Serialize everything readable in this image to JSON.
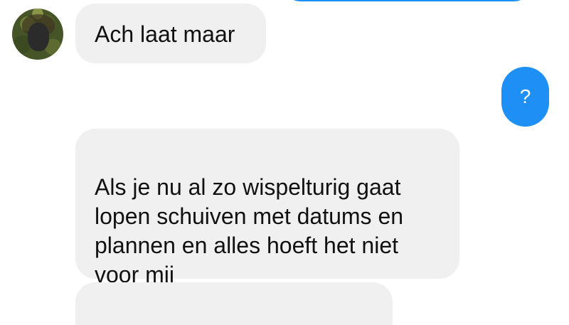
{
  "messages": [
    {
      "from": "contact",
      "text": "Ach laat maar"
    },
    {
      "from": "me",
      "text": "?"
    },
    {
      "from": "contact",
      "text": "Als je nu al zo wispelturig gaat\nlopen schuiven met datums en\nplannen en alles hoeft het niet\nvoor mij"
    },
    {
      "from": "contact",
      "text": ""
    }
  ],
  "colors": {
    "incoming_bubble": "#f0f0f0",
    "outgoing_bubble": "#1e8ff5",
    "incoming_text": "#111111",
    "outgoing_text": "#ffffff"
  }
}
